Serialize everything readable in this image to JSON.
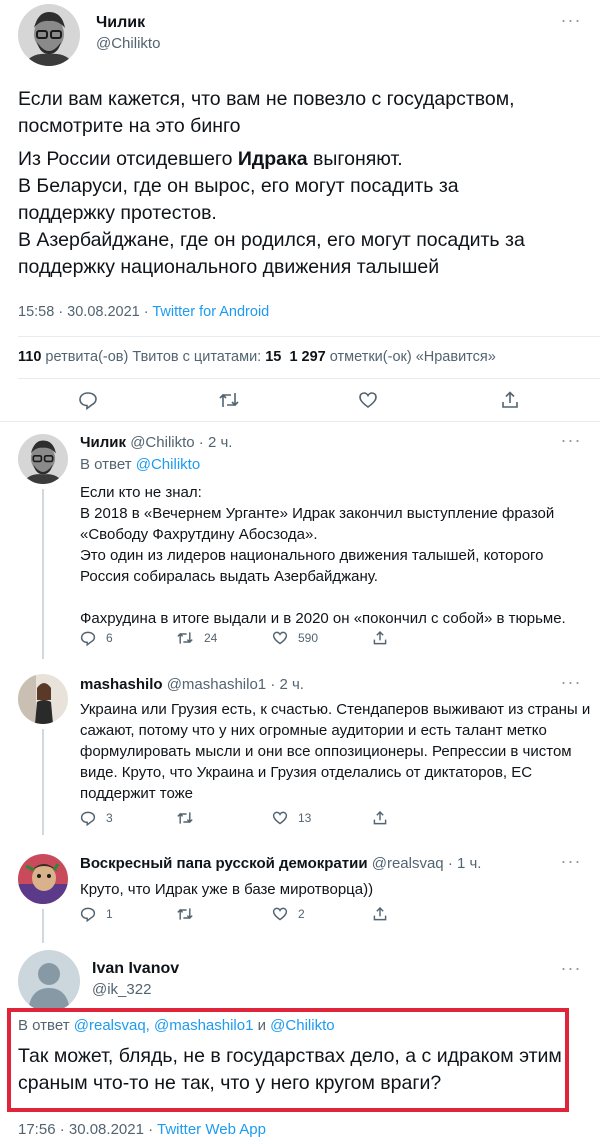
{
  "main_tweet": {
    "author_name": "Чилик",
    "author_handle": "@Chilikto",
    "text_1": "Если вам кажется, что вам не повезло с государством, посмотрите на это бинго",
    "text_2_before": "Из России отсидевшего ",
    "text_2_bold": "Идрака",
    "text_2_after": " выгоняют.",
    "text_3": "В Беларуси, где он вырос, его могут посадить за поддержку протестов.",
    "text_4": "В Азербайджане, где он родился, его могут посадить за поддержку национального движения талышей",
    "meta_time": "15:58 · 30.08.2021 · ",
    "meta_app": "Twitter for Android",
    "stats_retweets_num": "110",
    "stats_retweets_label": " ретвита(-ов)  Твитов с цитатами: ",
    "stats_quotes_num": "15",
    "stats_likes_num": "1 297",
    "stats_likes_label": " отметки(-ок) «Нравится»"
  },
  "reply_1": {
    "author_name": "Чилик",
    "author_handle": "@Chilikto",
    "time": " · 2 ч.",
    "reply_to_label": "В ответ ",
    "reply_to_handle": "@Chilikto",
    "lines": [
      "Если кто не знал:",
      "В 2018 в «Вечернем Урганте» Идрак закончил выступление фразой «Свободу Фахрутдину Абосзода».",
      "Это один из лидеров национального движения талышей, которого Россия собиралась выдать Азербайджану.",
      "Фахрудина в итоге выдали и в 2020 он «покончил с собой» в тюрьме."
    ],
    "replies": "6",
    "retweets": "24",
    "likes": "590"
  },
  "reply_2": {
    "author_name": "mashashilo",
    "author_handle": "@mashashilo1",
    "time": " · 2 ч.",
    "text": "Украина или Грузия есть, к счастью. Стендаперов выживают из страны и сажают, потому что у них огромные аудитории и есть талант метко формулировать мысли и они все оппозиционеры. Репрессии в чистом виде. Круто, что Украина и Грузия отделались от диктаторов, ЕС поддержит тоже",
    "replies": "3",
    "likes": "13"
  },
  "reply_3": {
    "author_name": "Воскресный папа русской демократии",
    "author_handle": "@realsvaq",
    "time": " · 1 ч.",
    "text": "Круто, что Идрак уже в базе миротворца))",
    "replies": "1",
    "likes": "2"
  },
  "focus_tweet": {
    "author_name": "Ivan Ivanov",
    "author_handle": "@ik_322",
    "reply_to_label": "В ответ ",
    "reply_to_handles": "@realsvaq, @mashashilo1",
    "reply_to_and": " и ",
    "reply_to_last": "@Chilikto",
    "text": "Так может, блядь, не в государствах дело, а с идраком этим сраным что-то не так, что у него кругом враги?",
    "meta_time": "17:56 · 30.08.2021 · ",
    "meta_app": "Twitter Web App"
  },
  "colors": {
    "link": "#1d9bf0",
    "muted": "#536471",
    "highlight_border": "#e0243a"
  }
}
